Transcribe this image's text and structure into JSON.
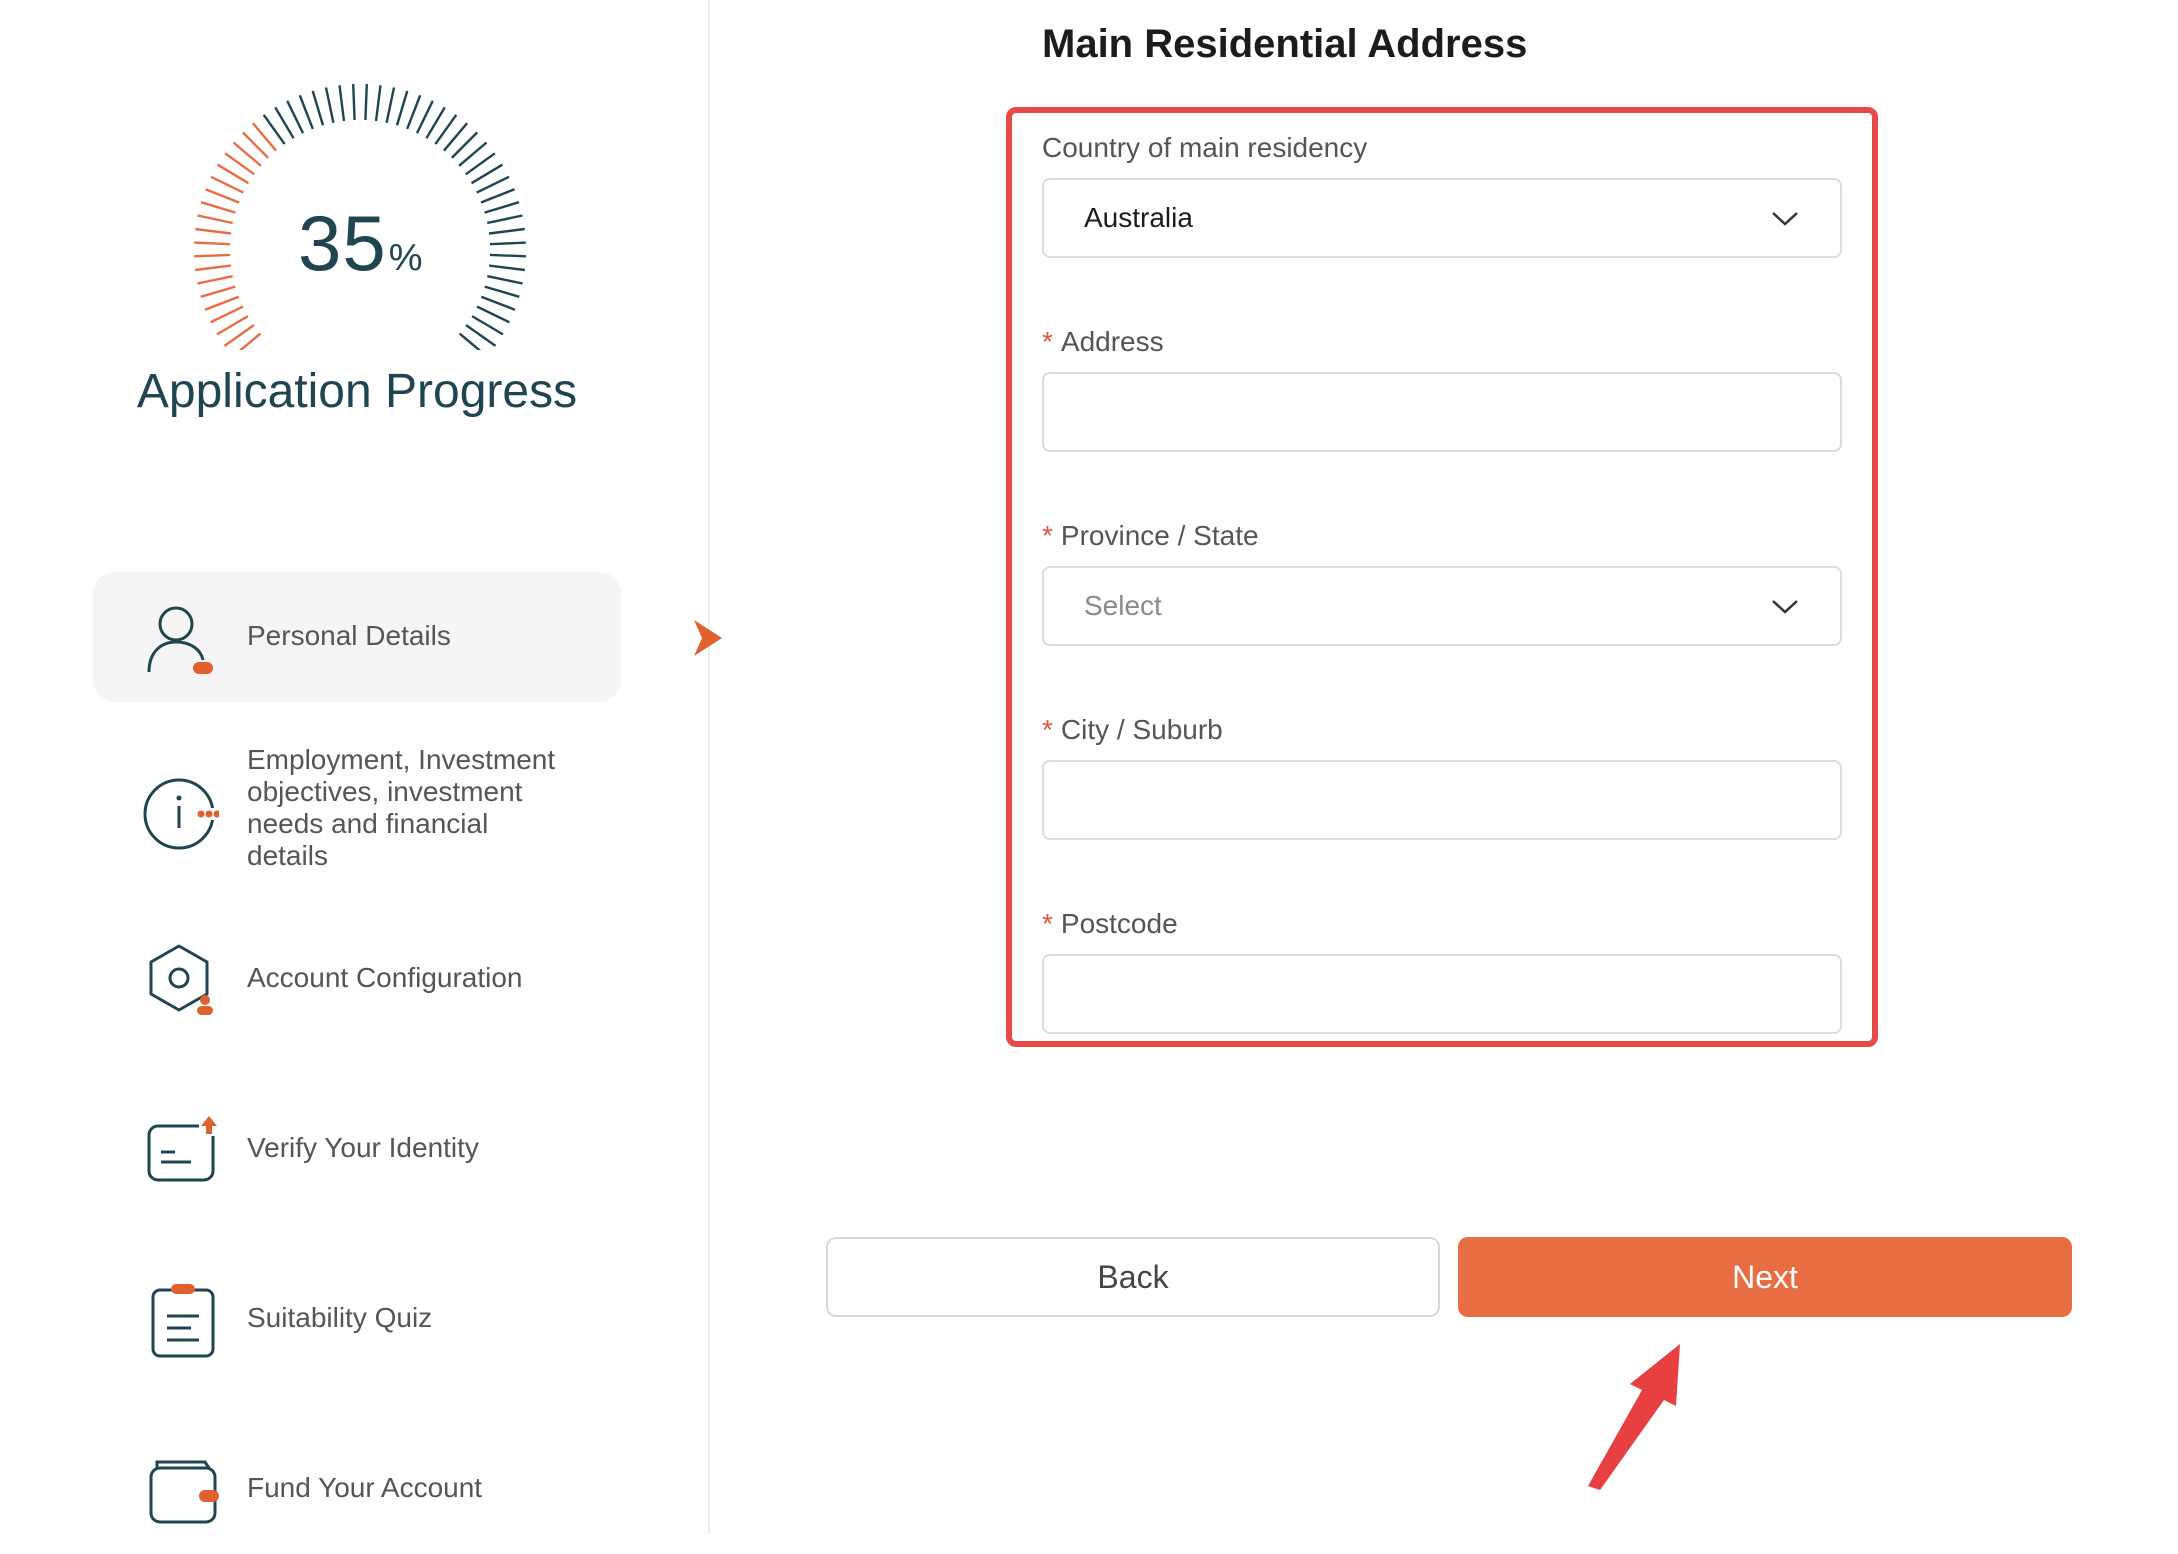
{
  "sidebar": {
    "progress": {
      "value": "35",
      "unit": "%",
      "fraction": 0.35
    },
    "progress_title": "Application Progress",
    "steps": [
      {
        "label": "Personal Details",
        "icon": "user-icon"
      },
      {
        "label": "Employment, Investment objectives, investment needs and financial details",
        "icon": "info-icon"
      },
      {
        "label": "Account Configuration",
        "icon": "settings-hex-icon"
      },
      {
        "label": "Verify Your Identity",
        "icon": "id-card-icon"
      },
      {
        "label": "Suitability Quiz",
        "icon": "clipboard-icon"
      },
      {
        "label": "Fund Your Account",
        "icon": "wallet-icon"
      }
    ]
  },
  "main": {
    "title": "Main Residential Address",
    "fields": {
      "country": {
        "label": "Country of main residency",
        "value": "Australia"
      },
      "address": {
        "label": "Address",
        "value": ""
      },
      "state": {
        "label": "Province / State",
        "placeholder": "Select"
      },
      "city": {
        "label": "City / Suburb",
        "value": ""
      },
      "postcode": {
        "label": "Postcode",
        "value": ""
      }
    },
    "required_mark": "*"
  },
  "actions": {
    "back_label": "Back",
    "next_label": "Next"
  },
  "colors": {
    "accent": "#e86d43",
    "highlight": "#e84a4a",
    "teal": "#1f4550"
  }
}
